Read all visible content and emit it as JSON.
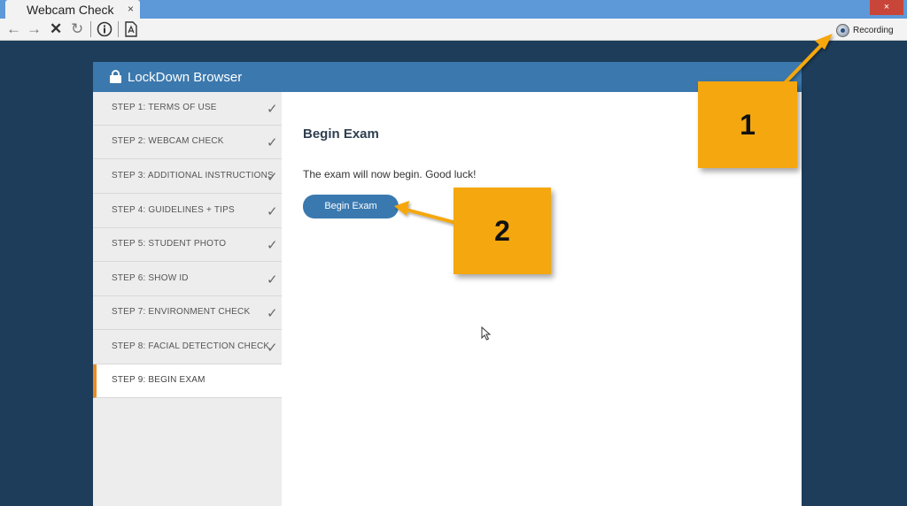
{
  "browser": {
    "tab_title": "Webcam Check",
    "tab_close": "×",
    "window_close": "×",
    "recording_label": "Recording"
  },
  "app": {
    "title": "LockDown Browser"
  },
  "sidebar": {
    "steps": [
      {
        "label": "STEP 1: TERMS OF USE",
        "check": "✓"
      },
      {
        "label": "STEP 2: WEBCAM CHECK",
        "check": "✓"
      },
      {
        "label": "STEP 3: ADDITIONAL INSTRUCTIONS",
        "check": "✓"
      },
      {
        "label": "STEP 4: GUIDELINES + TIPS",
        "check": "✓"
      },
      {
        "label": "STEP 5: STUDENT PHOTO",
        "check": "✓"
      },
      {
        "label": "STEP 6: SHOW ID",
        "check": "✓"
      },
      {
        "label": "STEP 7: ENVIRONMENT CHECK",
        "check": "✓"
      },
      {
        "label": "STEP 8: FACIAL DETECTION CHECK",
        "check": "✓"
      },
      {
        "label": "STEP 9: BEGIN EXAM",
        "check": ""
      }
    ],
    "active_step": 9
  },
  "main": {
    "title": "Begin Exam",
    "message": "The exam will now begin. Good luck!",
    "button_label": "Begin Exam"
  },
  "callouts": {
    "one": "1",
    "two": "2"
  },
  "colors": {
    "background": "#1d3d5a",
    "header": "#3b78ad",
    "button": "#3a79b0",
    "callout": "#f5a70f",
    "active_marker": "#e98d22"
  }
}
